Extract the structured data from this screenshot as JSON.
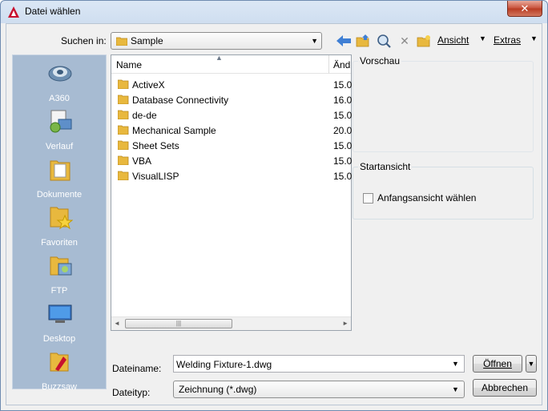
{
  "window": {
    "title": "Datei wählen",
    "close_label": "✕"
  },
  "lookin": {
    "label": "Suchen in:",
    "value": "Sample"
  },
  "toolbar": {
    "view_label": "Ansicht",
    "tools_label": "Extras"
  },
  "places": [
    {
      "label": "A360",
      "icon": "a360-icon"
    },
    {
      "label": "Verlauf",
      "icon": "history-icon"
    },
    {
      "label": "Dokumente",
      "icon": "documents-icon"
    },
    {
      "label": "Favoriten",
      "icon": "favorites-icon"
    },
    {
      "label": "FTP",
      "icon": "ftp-icon"
    },
    {
      "label": "Desktop",
      "icon": "desktop-icon"
    },
    {
      "label": "Buzzsaw",
      "icon": "buzzsaw-icon"
    }
  ],
  "filelist": {
    "columns": {
      "name": "Name",
      "date": "Änd"
    },
    "rows": [
      {
        "name": "ActiveX",
        "date": "15.0"
      },
      {
        "name": "Database Connectivity",
        "date": "16.0"
      },
      {
        "name": "de-de",
        "date": "15.0"
      },
      {
        "name": "Mechanical Sample",
        "date": "20.0"
      },
      {
        "name": "Sheet Sets",
        "date": "15.0"
      },
      {
        "name": "VBA",
        "date": "15.0"
      },
      {
        "name": "VisualLISP",
        "date": "15.0"
      }
    ]
  },
  "preview": {
    "title": "Vorschau"
  },
  "startview": {
    "title": "Startansicht",
    "checkbox_label": "Anfangsansicht wählen"
  },
  "filename": {
    "label": "Dateiname:",
    "value": "Welding Fixture-1.dwg"
  },
  "filetype": {
    "label": "Dateityp:",
    "value": "Zeichnung (*.dwg)"
  },
  "buttons": {
    "open": "Öffnen",
    "cancel": "Abbrechen"
  },
  "colors": {
    "places_bg": "#a7bbd2",
    "folder": "#e8b83e"
  }
}
